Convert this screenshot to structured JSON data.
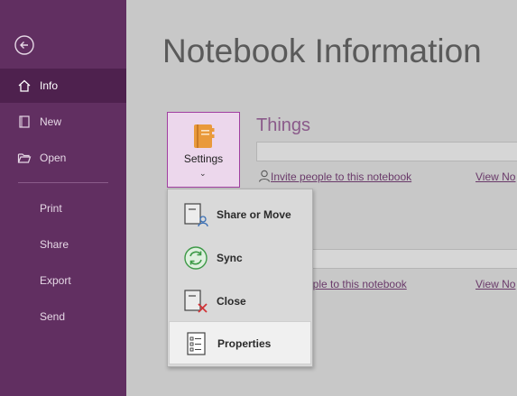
{
  "nav": {
    "items": [
      {
        "label": "Info",
        "icon": "home-icon"
      },
      {
        "label": "New",
        "icon": "new-notebook-icon"
      },
      {
        "label": "Open",
        "icon": "folder-open-icon"
      },
      {
        "label": "Print"
      },
      {
        "label": "Share"
      },
      {
        "label": "Export"
      },
      {
        "label": "Send"
      }
    ]
  },
  "main": {
    "title": "Notebook Information",
    "settings_button": {
      "label": "Settings",
      "chevron": "⌄"
    },
    "notebook": {
      "name": "Things",
      "invite_label": "Invite people to this notebook",
      "view_label": "View No",
      "invite_label_2": "ople to this notebook",
      "view_label_2": "View No"
    }
  },
  "dropdown": {
    "items": [
      {
        "label": "Share or Move",
        "icon": "share-move-icon"
      },
      {
        "label": "Sync",
        "icon": "sync-icon"
      },
      {
        "label": "Close",
        "icon": "close-notebook-icon"
      },
      {
        "label": "Properties",
        "icon": "properties-icon"
      }
    ]
  },
  "colors": {
    "sidebar": "#612f61",
    "sidebar_active": "#4e214e",
    "accent": "#a03fa0",
    "background": "#c8c8c8"
  }
}
